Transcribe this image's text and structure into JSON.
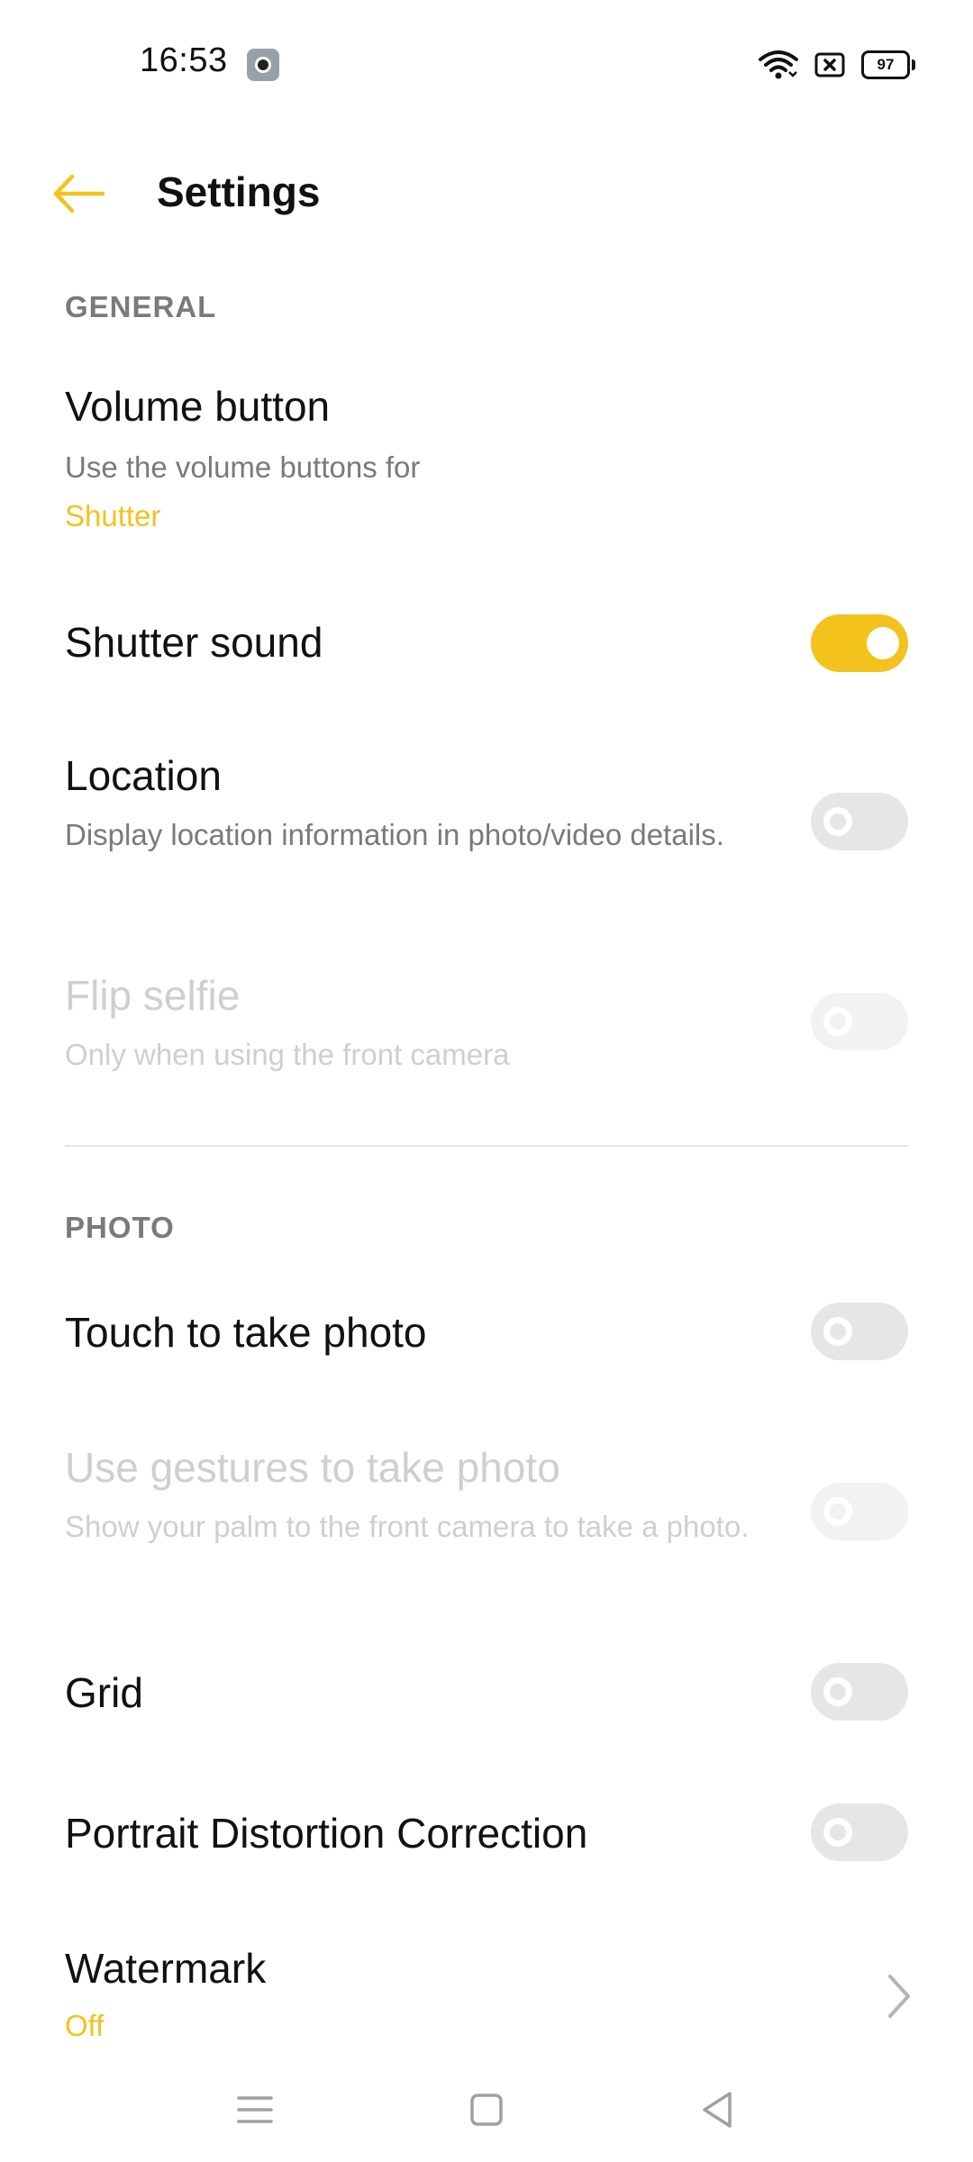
{
  "status_bar": {
    "time": "16:53",
    "battery": "97"
  },
  "header": {
    "title": "Settings"
  },
  "sections": {
    "general": "GENERAL",
    "photo": "PHOTO"
  },
  "items": {
    "volume_button": {
      "title": "Volume button",
      "subtitle": "Use the volume buttons for",
      "value": "Shutter"
    },
    "shutter_sound": {
      "title": "Shutter sound",
      "enabled": true
    },
    "location": {
      "title": "Location",
      "subtitle": "Display location information in photo/video details.",
      "enabled": false
    },
    "flip_selfie": {
      "title": "Flip selfie",
      "subtitle": "Only when using the front camera",
      "enabled": false,
      "disabled": true
    },
    "touch_photo": {
      "title": "Touch to take photo",
      "enabled": false
    },
    "gestures_photo": {
      "title": "Use gestures to take photo",
      "subtitle": "Show your palm to the front camera to take a photo.",
      "enabled": false,
      "disabled": true
    },
    "grid": {
      "title": "Grid",
      "enabled": false
    },
    "portrait_distortion": {
      "title": "Portrait Distortion Correction",
      "enabled": false
    },
    "watermark": {
      "title": "Watermark",
      "value": "Off"
    }
  },
  "colors": {
    "accent": "#f4c21c",
    "section_text": "#7a7a7a",
    "disabled_text": "#cfcfcf"
  },
  "icons": [
    "wifi-icon",
    "sim-off-icon",
    "battery-icon",
    "back-arrow-icon",
    "chevron-right-icon",
    "menu-icon",
    "home-icon",
    "back-icon"
  ]
}
